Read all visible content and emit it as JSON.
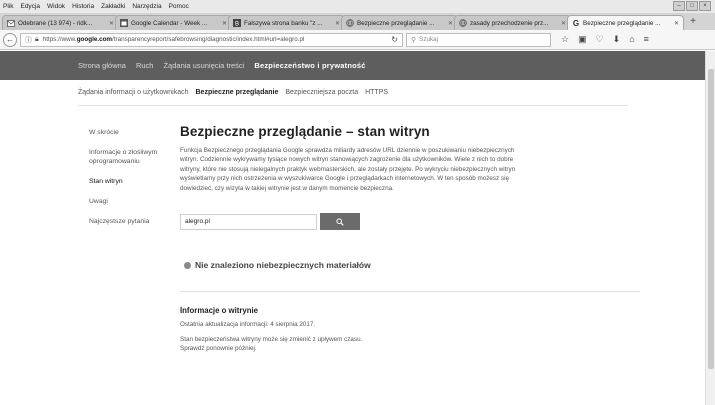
{
  "menu": [
    "Plik",
    "Edycja",
    "Widok",
    "Historia",
    "Zakładki",
    "Narzędzia",
    "Pomoc"
  ],
  "window_controls": [
    "–",
    "□",
    "×"
  ],
  "tabs": [
    {
      "title": "Odebrane (13 974) - ridk...",
      "icon": "mail-icon"
    },
    {
      "title": "Google Calendar - Week ...",
      "icon": "calendar-icon"
    },
    {
      "title": "Fałszywa strona banku \"z ...",
      "icon": "bank-icon"
    },
    {
      "title": "Bezpieczne przeglądanie ...",
      "icon": "globe-icon"
    },
    {
      "title": "zasady przechodzenie prz...",
      "icon": "globe-icon"
    },
    {
      "title": "Bezpieczne przeglądanie ...",
      "icon": "google-icon",
      "active": true
    }
  ],
  "newtab": "+",
  "address": {
    "prefix": "https://www.",
    "domain": "google.com",
    "path": "/transparencyreport/safebrowsing/diagnostic/index.html#url=alegro.pl",
    "search_placeholder": "Szukaj"
  },
  "gheader": {
    "items": [
      "Strona główna",
      "Ruch",
      "Żądania usunięcia treści"
    ],
    "active": "Bezpieczeństwo i prywatność"
  },
  "subnav": {
    "items": [
      "Żądania informacji o użytkownikach"
    ],
    "current": "Bezpieczne przeglądanie",
    "after": [
      "Bezpieczniejsza poczta",
      "HTTPS"
    ]
  },
  "sidebar": [
    {
      "label": "W skrócie"
    },
    {
      "label": "Informacje o złośliwym oprogramowaniu"
    },
    {
      "label": "Stan witryn",
      "active": true
    },
    {
      "label": "Uwagi"
    },
    {
      "label": "Najczęstsze pytania"
    }
  ],
  "main": {
    "title": "Bezpieczne przeglądanie – stan witryn",
    "description": "Funkcja Bezpiecznego przeglądania Google sprawdza miliardy adresów URL dziennie w poszukiwaniu niebezpiecznych witryn. Codziennie wykrywamy tysiące nowych witryn stanowiących zagrożenie dla użytkowników. Wiele z nich to dobre witryny, które nie stosują nielegalnych praktyk webmasterskich, ale zostały przejęte. Po wykryciu niebezpiecznych witryn wyświetlamy przy nich ostrzeżenia w wyszukiwarce Google i przeglądarkach internetowych. W ten sposób możesz się dowiedzieć, czy wizyta w takiej witrynie jest w danym momencie bezpieczna.",
    "input_value": "alegro.pl",
    "result": "Nie znaleziono niebezpiecznych materiałów",
    "info_heading": "Informacje o witrynie",
    "last_update": "Ostatnia aktualizacja informacji: 4 sierpnia 2017.",
    "note_line1": "Stan bezpieczeństwa witryny może się zmienić z upływem czasu.",
    "note_line2": "Sprawdź ponownie później."
  }
}
